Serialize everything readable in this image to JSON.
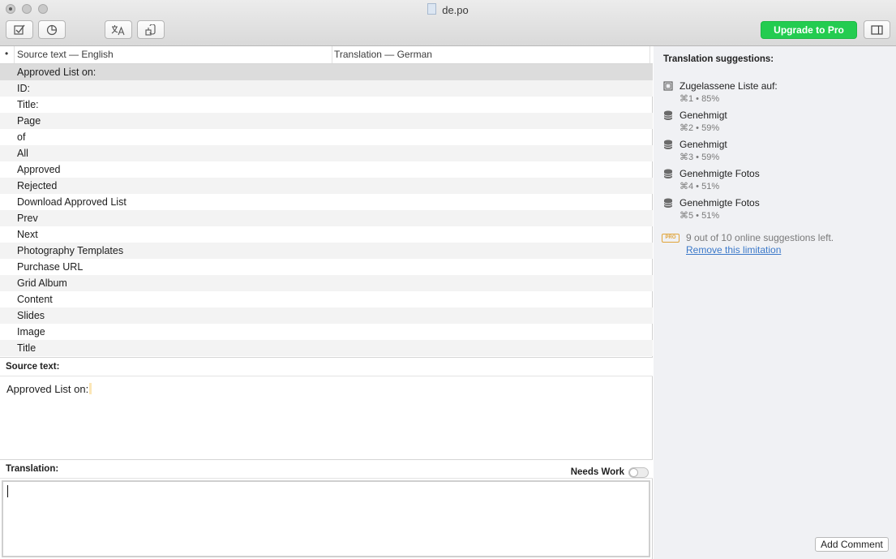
{
  "window": {
    "title": "de.po"
  },
  "toolbar": {
    "buttons": [
      {
        "name": "validate-button",
        "icon": "checkbox-icon"
      },
      {
        "name": "history-button",
        "icon": "pie-clock-icon"
      },
      {
        "name": "translate-button",
        "icon": "translate-icon"
      },
      {
        "name": "pretranslate-button",
        "icon": "database-arrow-icon"
      }
    ],
    "upgrade_label": "Upgrade to Pro",
    "sidebar_toggle_icon": "sidebar-icon"
  },
  "table": {
    "columns": {
      "marker": "•",
      "source": "Source text — English",
      "translation": "Translation — German"
    },
    "rows": [
      {
        "source": "Approved List on:",
        "translation": ""
      },
      {
        "source": "ID:",
        "translation": ""
      },
      {
        "source": "Title:",
        "translation": ""
      },
      {
        "source": "Page",
        "translation": ""
      },
      {
        "source": "of",
        "translation": ""
      },
      {
        "source": "All",
        "translation": ""
      },
      {
        "source": "Approved",
        "translation": ""
      },
      {
        "source": "Rejected",
        "translation": ""
      },
      {
        "source": "Download Approved List",
        "translation": ""
      },
      {
        "source": "Prev",
        "translation": ""
      },
      {
        "source": "Next",
        "translation": ""
      },
      {
        "source": "Photography Templates",
        "translation": ""
      },
      {
        "source": "Purchase URL",
        "translation": ""
      },
      {
        "source": "Grid Album",
        "translation": ""
      },
      {
        "source": "Content",
        "translation": ""
      },
      {
        "source": "Slides",
        "translation": ""
      },
      {
        "source": "Image",
        "translation": ""
      },
      {
        "source": "Title",
        "translation": ""
      }
    ],
    "selected_index": 0
  },
  "editor": {
    "source_label": "Source text:",
    "source_value": "Approved List on:",
    "translation_label": "Translation:",
    "needs_work_label": "Needs Work",
    "needs_work_on": false,
    "translation_value": ""
  },
  "suggestions": {
    "title": "Translation suggestions:",
    "items": [
      {
        "text": "Zugelassene Liste auf:",
        "meta": "⌘1 • 85%",
        "icon": "machine-translation-icon"
      },
      {
        "text": "Genehmigt",
        "meta": "⌘2 • 59%",
        "icon": "database-icon"
      },
      {
        "text": "Genehmigt",
        "meta": "⌘3 • 59%",
        "icon": "database-icon"
      },
      {
        "text": "Genehmigte Fotos",
        "meta": "⌘4 • 51%",
        "icon": "database-icon"
      },
      {
        "text": "Genehmigte Fotos",
        "meta": "⌘5 • 51%",
        "icon": "database-icon"
      }
    ],
    "pro_badge": "PRO",
    "pro_note": "9 out of 10 online suggestions left.",
    "pro_link": "Remove this limitation",
    "add_comment_label": "Add Comment"
  },
  "colors": {
    "accent_green": "#23cc50",
    "link_blue": "#3a78c9",
    "pro_orange": "#e0a43a",
    "selected_row": "#dcdcdc"
  }
}
